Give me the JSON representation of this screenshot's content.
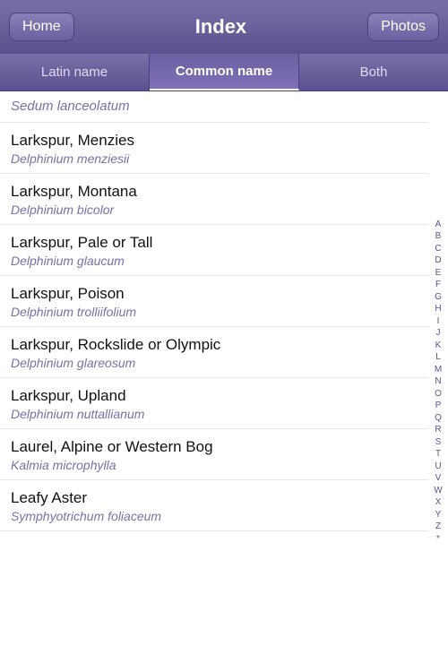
{
  "header": {
    "home_label": "Home",
    "title": "Index",
    "photos_label": "Photos"
  },
  "tabs": [
    {
      "id": "latin",
      "label": "Latin name",
      "active": false
    },
    {
      "id": "common",
      "label": "Common name",
      "active": true
    },
    {
      "id": "both",
      "label": "Both",
      "active": false
    }
  ],
  "first_item": {
    "latin_name": "Sedum lanceolatum"
  },
  "items": [
    {
      "common_name": "Larkspur, Menzies",
      "latin_name": "Delphinium menziesii"
    },
    {
      "common_name": "Larkspur, Montana",
      "latin_name": "Delphinium bicolor"
    },
    {
      "common_name": "Larkspur, Pale or Tall",
      "latin_name": "Delphinium glaucum"
    },
    {
      "common_name": "Larkspur, Poison",
      "latin_name": "Delphinium trolliifolium"
    },
    {
      "common_name": "Larkspur, Rockslide or Olympic",
      "latin_name": "Delphinium glareosum"
    },
    {
      "common_name": "Larkspur, Upland",
      "latin_name": "Delphinium nuttallianum"
    },
    {
      "common_name": "Laurel, Alpine or Western Bog",
      "latin_name": "Kalmia microphylla"
    },
    {
      "common_name": "Leafy Aster",
      "latin_name": "Symphyotrichum foliaceum"
    }
  ],
  "alphabet": [
    "A",
    "B",
    "C",
    "D",
    "E",
    "F",
    "G",
    "H",
    "I",
    "J",
    "K",
    "L",
    "M",
    "N",
    "O",
    "P",
    "Q",
    "R",
    "S",
    "T",
    "U",
    "V",
    "W",
    "X",
    "Y",
    "Z",
    "*"
  ]
}
